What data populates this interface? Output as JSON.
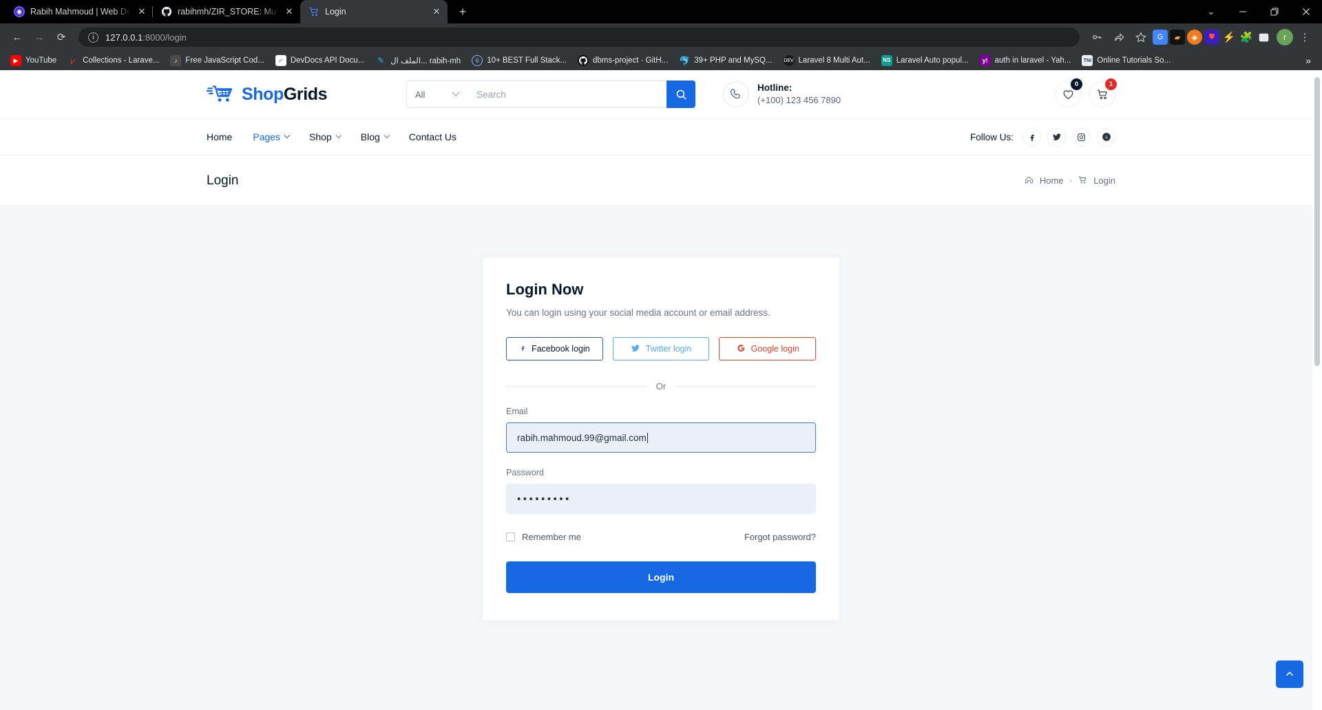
{
  "browser": {
    "tabs": [
      {
        "title": "Rabih Mahmoud | Web Develope",
        "icon": "profile-icon",
        "active": false
      },
      {
        "title": "rabihmh/ZIR_STORE: Multi vendo",
        "icon": "github-icon",
        "active": false
      },
      {
        "title": "Login",
        "icon": "cart-icon",
        "active": true
      }
    ],
    "new_tab_label": "+",
    "window_controls": {
      "minimize": "—",
      "restore": "❐",
      "close": "✕",
      "tab_search": "⌄"
    },
    "nav": {
      "back": "←",
      "forward": "→",
      "reload": "⟳"
    },
    "omnibox": {
      "host": "127.0.0.1",
      "rest": ":8000/login",
      "info_icon": "i"
    },
    "toolbar_icons": [
      "key-icon",
      "share-icon",
      "star-icon",
      "translate-extension-icon",
      "dark-reader-extension-icon",
      "orange-extension-icon",
      "bitwarden-extension-icon",
      "lightning-extension-icon",
      "puzzle-extensions-icon",
      "sidepanel-icon"
    ],
    "avatar_letter": "r",
    "menu_icon": "⋮",
    "bookmarks": [
      {
        "label": "YouTube",
        "icon": "youtube-icon"
      },
      {
        "label": "Collections - Larave...",
        "icon": "laravel-icon"
      },
      {
        "label": "Free JavaScript Cod...",
        "icon": "js-icon"
      },
      {
        "label": "DevDocs API Docu...",
        "icon": "devdocs-icon"
      },
      {
        "label": "الملف ال... rabih-mh",
        "icon": "feather-icon"
      },
      {
        "label": "10+ BEST Full Stack...",
        "icon": "circle-icon"
      },
      {
        "label": "dbms-project · GitH...",
        "icon": "github-icon"
      },
      {
        "label": "39+ PHP and MySQ...",
        "icon": "php-icon"
      },
      {
        "label": "Laravel 8 Multi Aut...",
        "icon": "dark-circle-icon"
      },
      {
        "label": "Laravel Auto popul...",
        "icon": "ns-icon"
      },
      {
        "label": "auth in laravel - Yah...",
        "icon": "yahoo-icon"
      },
      {
        "label": "Online Tutorials So...",
        "icon": "tni-icon"
      }
    ],
    "bookmarks_overflow": "»"
  },
  "site": {
    "logo": {
      "first": "Shop",
      "second": "Grids",
      "icon": "shopping-cart-logo-icon"
    },
    "search": {
      "category": "All",
      "placeholder": "Search",
      "button_icon": "search-icon"
    },
    "hotline": {
      "title": "Hotline:",
      "number": "(+100) 123 456 7890",
      "icon": "phone-icon"
    },
    "actions": {
      "wishlist": {
        "icon": "heart-icon",
        "count": "0"
      },
      "cart": {
        "icon": "cart-icon",
        "count": "1"
      }
    },
    "nav": [
      {
        "label": "Home",
        "has_dropdown": false,
        "active": false
      },
      {
        "label": "Pages",
        "has_dropdown": true,
        "active": true
      },
      {
        "label": "Shop",
        "has_dropdown": true,
        "active": false
      },
      {
        "label": "Blog",
        "has_dropdown": true,
        "active": false
      },
      {
        "label": "Contact Us",
        "has_dropdown": false,
        "active": false
      }
    ],
    "follow": {
      "label": "Follow Us:",
      "socials": [
        "facebook-icon",
        "twitter-icon",
        "instagram-icon",
        "skype-icon"
      ]
    },
    "breadcrumb": {
      "title": "Login",
      "home": "Home",
      "separator": "›",
      "current": "Login",
      "home_icon": "home-icon",
      "current_icon": "cart-icon"
    }
  },
  "login": {
    "title": "Login Now",
    "subtitle": "You can login using your social media account or email address.",
    "social_buttons": [
      {
        "label": "Facebook login",
        "icon": "facebook-icon",
        "glyph": "f"
      },
      {
        "label": "Twitter login",
        "icon": "twitter-icon",
        "glyph": "🐦"
      },
      {
        "label": "Google login",
        "icon": "google-icon",
        "glyph": "G"
      }
    ],
    "or_text": "Or",
    "email": {
      "label": "Email",
      "value": "rabih.mahmoud.99@gmail.com"
    },
    "password": {
      "label": "Password",
      "value": "•••••••••"
    },
    "remember_label": "Remember me",
    "forgot_label": "Forgot password?",
    "submit_label": "Login"
  },
  "scroll_top_icon": "chevron-up-icon"
}
